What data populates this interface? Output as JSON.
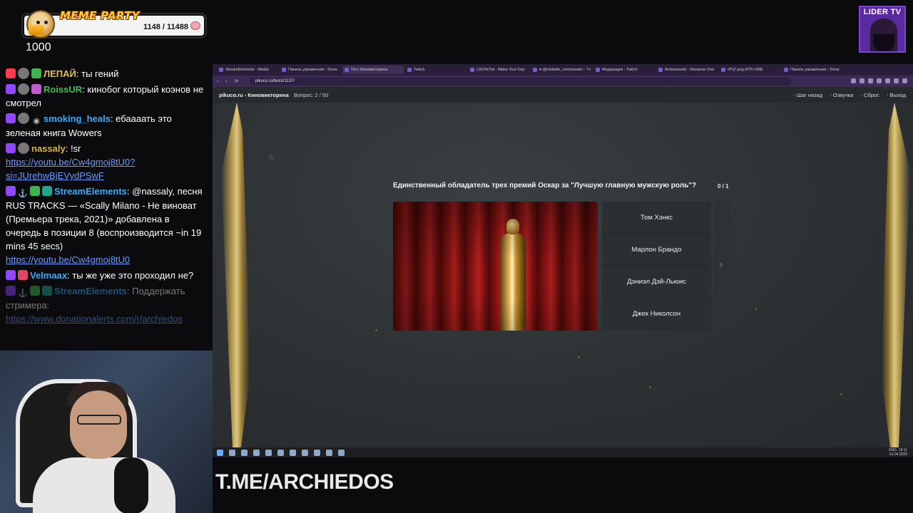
{
  "meme_widget": {
    "title": "MEME PARTY",
    "count": "1148 / 11488",
    "progress": 0.1,
    "value": "1000"
  },
  "channel_logo": {
    "text": "LIDER TV"
  },
  "chat": [
    {
      "user": "ЛЕПАЙ",
      "sep": ": ",
      "text": "ты гений",
      "color": "#e0c040",
      "badges": [
        "live-badge",
        "avatar",
        "sub-badge"
      ]
    },
    {
      "user": "RoissUR",
      "sep": ": ",
      "text": "кинобог который коэнов не смотрел",
      "color": "#3fbf4f",
      "badges": [
        "twitch-badge",
        "avatar",
        "pink-badge"
      ]
    },
    {
      "user": "smoking_heals",
      "sep": ": ",
      "text": "ебаааать это зеленая книга Wowers",
      "color": "#3fa9f5",
      "badges": [
        "twitch-badge",
        "avatar",
        "eye-badge"
      ]
    },
    {
      "user": "nassaly",
      "sep": ": ",
      "text": "!sr",
      "link": "https://youtu.be/Cw4gmoj8tU0?si=JUrehwBjEVydPSwF",
      "color": "#d9b040",
      "badges": [
        "twitch-badge",
        "avatar"
      ]
    },
    {
      "user": "StreamElements",
      "sep": ": ",
      "text": "@nassaly, песня RUS TRACKS — «Scally Milano - Не виноват (Премьера трека, 2021)» добавлена в очередь в позиции 8 (воспроизводится ~in 19 mins 45 secs)",
      "link": "https://youtu.be/Cw4gmoj8tU0",
      "color": "#3fa9f5",
      "badges": [
        "twitch-badge",
        "anchor-badge",
        "green-badge",
        "teal-badge"
      ]
    },
    {
      "user": "Velmaax",
      "sep": ": ",
      "text": "ты же уже это проходил не?",
      "color": "#3fa9f5",
      "badges": [
        "twitch-badge",
        "heart-badge"
      ]
    },
    {
      "user": "StreamElements",
      "sep": ": ",
      "text": "Поддержать стримера:",
      "link": "https://www.donationalerts.com/r/archiedos",
      "color": "#3fa9f5",
      "badges": [
        "twitch-badge",
        "anchor-badge",
        "green-badge",
        "teal-badge"
      ],
      "faded": true
    }
  ],
  "browser": {
    "tabs": [
      "StreamElements - Media",
      "Панель управления - Dona",
      "Тест Киновикторина",
      "Twitch",
      "(19)TikTok - Make Your Day",
      "● @midside_commander - Tv",
      "Модерация - Twitch",
      "Arrowwoods - Streamer Ove",
      "dTlj7.png (675×188)",
      "Панель управления - Dona"
    ],
    "active_tab": 2,
    "url": "pikuco.ru/tests/1137/"
  },
  "site": {
    "brand": "pikuco.ru - Киновикторина",
    "progress_label": "Вопрос: 2 / 50",
    "actions": [
      "Шаг назад",
      "Озвучка",
      "Сброс",
      "Выход"
    ],
    "question": "Единственный обладатель трех премий Оскар за \"Лучшую главную мужскую роль\"?",
    "score": "0 / 1",
    "answers": [
      "Том Хэнкс",
      "Марлон Брандо",
      "Дэниэл Дэй-Льюис",
      "Джек Николсон"
    ],
    "next_icon": "chevron-right-icon"
  },
  "taskbar": {
    "lang": "ENG",
    "time": "19:11",
    "date": "01.04.2025"
  },
  "overlay": {
    "telegram": "T.ME/ARCHIEDOS"
  }
}
